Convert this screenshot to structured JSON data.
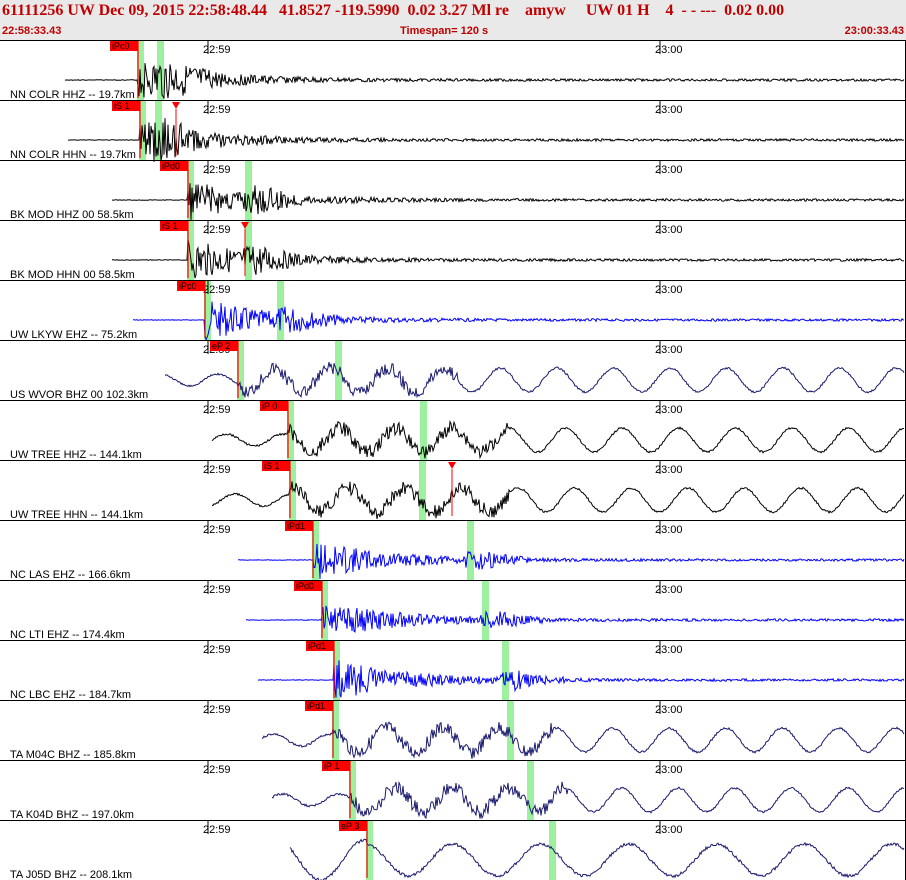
{
  "header": {
    "title": "61111256 UW Dec 09, 2015 22:58:48.44   41.8527 -119.5990  0.02 3.27 Ml re    amyw     UW 01 H    4  - - ---  0.02 0.00",
    "start_time": "22:58:33.43",
    "timespan": "Timespan= 120 s",
    "end_time": "23:00:33.43"
  },
  "time_marks": [
    "22:59",
    "23:00"
  ],
  "colors": {
    "header_bg": "#e9e9e9",
    "title": "#c00000",
    "pick_flag": "#ff0000",
    "window": "#9df09d",
    "trace_black": "#000000",
    "trace_blue": "#0000ff",
    "trace_navy": "#1a1a6e"
  },
  "channels": [
    {
      "label": "NN COLR HHZ -- 19.7km",
      "pick": "iPc0",
      "color": "black"
    },
    {
      "label": "NN COLR HHN -- 19.7km",
      "pick": "iS 1",
      "color": "black"
    },
    {
      "label": "BK MOD HHZ 00 58.5km",
      "pick": "iPd0",
      "color": "black"
    },
    {
      "label": "BK MOD HHN 00 58.5km",
      "pick": "iS 1",
      "color": "black"
    },
    {
      "label": "UW LKYW EHZ -- 75.2km",
      "pick": "iPc0",
      "color": "blue"
    },
    {
      "label": "US WVOR BHZ 00 102.3km",
      "pick": "eP 2",
      "color": "navy"
    },
    {
      "label": "UW TREE HHZ -- 144.1km",
      "pick": "iP 0",
      "color": "black"
    },
    {
      "label": "UW TREE HHN -- 144.1km",
      "pick": "iS 1",
      "color": "black"
    },
    {
      "label": "NC LAS EHZ -- 166.6km",
      "pick": "iPd1",
      "color": "blue"
    },
    {
      "label": "NC LTI EHZ -- 174.4km",
      "pick": "iPd0",
      "color": "blue"
    },
    {
      "label": "NC LBC EHZ -- 184.7km",
      "pick": "iPd1",
      "color": "blue"
    },
    {
      "label": "TA M04C BHZ -- 185.8km",
      "pick": "iPd1",
      "color": "navy"
    },
    {
      "label": "TA K04D BHZ -- 197.0km",
      "pick": "iP 1",
      "color": "navy"
    },
    {
      "label": "TA J05D BHZ -- 208.1km",
      "pick": "eP 3",
      "color": "navy"
    }
  ]
}
